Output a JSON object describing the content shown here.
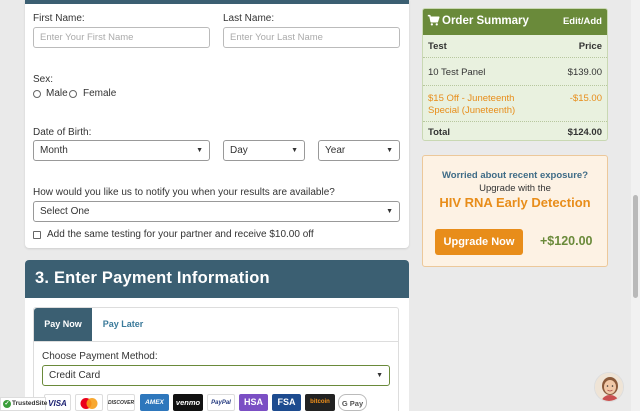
{
  "form": {
    "first_name_label": "First Name:",
    "first_name_placeholder": "Enter Your First Name",
    "last_name_label": "Last Name:",
    "last_name_placeholder": "Enter Your Last Name",
    "sex_label": "Sex:",
    "sex_options": [
      "Male",
      "Female"
    ],
    "dob_label": "Date of Birth:",
    "dob_month": "Month",
    "dob_day": "Day",
    "dob_year": "Year",
    "notify_label": "How would you like us to notify you when your results are available?",
    "notify_value": "Select One",
    "partner_label": "Add the same testing for your partner and receive $10.00 off"
  },
  "payment": {
    "header": "3. Enter Payment Information",
    "tab_now": "Pay Now",
    "tab_later": "Pay Later",
    "method_label": "Choose Payment Method:",
    "method_value": "Credit Card",
    "logos": [
      "VISA",
      "Mastercard",
      "DISCOVER",
      "AMEX",
      "venmo",
      "PayPal",
      "HSA",
      "FSA",
      "bitcoin",
      "G Pay"
    ]
  },
  "summary": {
    "title": "Order Summary",
    "edit": "Edit/Add",
    "col_test": "Test",
    "col_price": "Price",
    "item_name": "10 Test Panel",
    "item_price": "$139.00",
    "discount_name": "$15 Off - Juneteenth Special (Juneteenth)",
    "discount_price": "-$15.00",
    "total_label": "Total",
    "total_value": "$124.00"
  },
  "upgrade": {
    "worried": "Worried about recent exposure?",
    "with": "Upgrade with the",
    "title": "HIV RNA Early Detection",
    "button": "Upgrade Now",
    "price": "+$120.00"
  },
  "badges": {
    "trusted": "TrustedSite"
  },
  "colors": {
    "header_blue": "#3b5f72",
    "summary_green": "#6a8a3a",
    "accent_orange": "#e88d1a"
  }
}
